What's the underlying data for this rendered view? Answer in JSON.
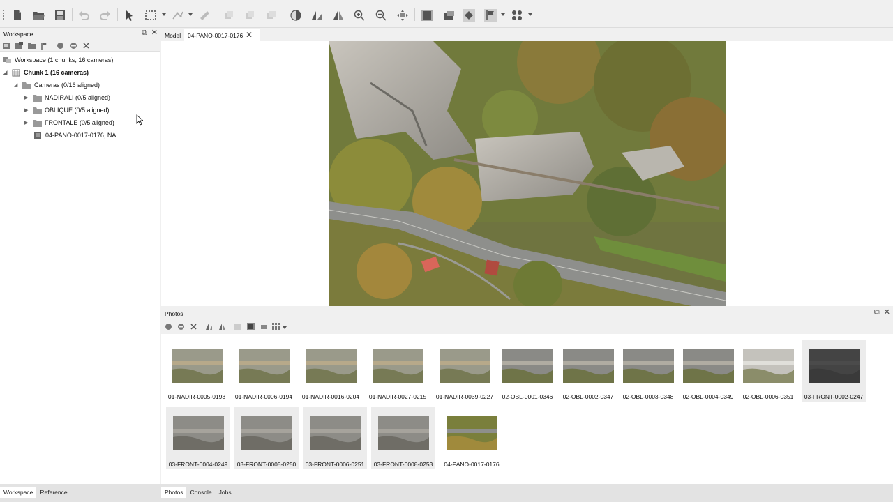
{
  "toolbar": {
    "icons": [
      "new-document-icon",
      "open-folder-icon",
      "save-icon",
      "undo-icon",
      "redo-icon",
      "navigation-icon",
      "rectangle-selection-icon",
      "draw-polyline-icon",
      "ruler-icon",
      "shape-icon-1",
      "shape-icon-2",
      "shape-icon-3",
      "contrast-icon",
      "align-icon",
      "mirror-icon",
      "zoom-in-icon",
      "zoom-out-icon",
      "reset-view-icon",
      "mask-icon",
      "mask-tool-icon",
      "magic-wand-icon",
      "flag-icon",
      "grid-view-icon"
    ]
  },
  "workspace": {
    "title": "Workspace",
    "tree": {
      "root": "Workspace (1 chunks, 16 cameras)",
      "chunk": "Chunk 1 (16 cameras)",
      "cameras": "Cameras (0/16 aligned)",
      "groups": [
        {
          "label": "NADIRALI (0/5 aligned)"
        },
        {
          "label": "OBLIQUE (0/5 aligned)"
        },
        {
          "label": "FRONTALE (0/5 aligned)"
        }
      ],
      "single_camera": "04-PANO-0017-0176, NA"
    }
  },
  "left_bottom_tabs": {
    "workspace": "Workspace",
    "reference": "Reference"
  },
  "doc_tabs": {
    "model": "Model",
    "photo": "04-PANO-0017-0176"
  },
  "photos": {
    "title": "Photos",
    "thumbnails": [
      {
        "label": "01-NADIR-0005-0193",
        "kind": "nadir"
      },
      {
        "label": "01-NADIR-0006-0194",
        "kind": "nadir"
      },
      {
        "label": "01-NADIR-0016-0204",
        "kind": "nadir"
      },
      {
        "label": "01-NADIR-0027-0215",
        "kind": "nadir"
      },
      {
        "label": "01-NADIR-0039-0227",
        "kind": "nadir"
      },
      {
        "label": "02-OBL-0001-0346",
        "kind": "oblique"
      },
      {
        "label": "02-OBL-0002-0347",
        "kind": "oblique"
      },
      {
        "label": "02-OBL-0003-0348",
        "kind": "oblique"
      },
      {
        "label": "02-OBL-0004-0349",
        "kind": "oblique"
      },
      {
        "label": "02-OBL-0006-0351",
        "kind": "oblique-light"
      },
      {
        "label": "03-FRONT-0002-0247",
        "kind": "dark"
      },
      {
        "label": "03-FRONT-0004-0249",
        "kind": "front"
      },
      {
        "label": "03-FRONT-0005-0250",
        "kind": "front"
      },
      {
        "label": "03-FRONT-0006-0251",
        "kind": "front"
      },
      {
        "label": "03-FRONT-0008-0253",
        "kind": "front"
      },
      {
        "label": "04-PANO-0017-0176",
        "kind": "pano"
      }
    ]
  },
  "bottom_tabs": {
    "photos": "Photos",
    "console": "Console",
    "jobs": "Jobs"
  }
}
